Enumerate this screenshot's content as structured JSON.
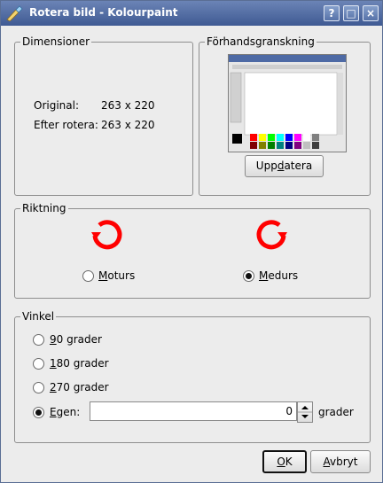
{
  "window": {
    "title": "Rotera bild - Kolourpaint",
    "icon": "kolourpaint-brush-icon",
    "buttons": [
      "?",
      "□",
      "×"
    ]
  },
  "dimensions": {
    "title": "Dimensioner",
    "original_label": "Original:",
    "original_value": "263 x 220",
    "after_label": "Efter rotera:",
    "after_value": "263 x 220"
  },
  "preview": {
    "title": "Förhandsgranskning",
    "update_button": {
      "before": "Upp",
      "mnemonic": "d",
      "after": "atera"
    }
  },
  "direction": {
    "title": "Riktning",
    "counterclockwise": {
      "mnemonic": "M",
      "rest": "oturs",
      "checked": false,
      "icon": "rotate-counterclockwise-icon"
    },
    "clockwise": {
      "mnemonic": "M",
      "rest": "edurs",
      "checked": true,
      "icon": "rotate-clockwise-icon"
    }
  },
  "angle": {
    "title": "Vinkel",
    "opt90": {
      "mnemonic": "9",
      "rest": "0 grader",
      "checked": false
    },
    "opt180": {
      "mnemonic": "1",
      "rest": "80 grader",
      "checked": false
    },
    "opt270": {
      "mnemonic": "2",
      "rest": "70 grader",
      "checked": false
    },
    "custom": {
      "mnemonic": "E",
      "rest": "gen:",
      "checked": true,
      "value": "0",
      "unit": "grader"
    }
  },
  "ok_button": {
    "mnemonic": "O",
    "rest": "K"
  },
  "cancel_button": {
    "mnemonic": "A",
    "rest": "vbryt"
  },
  "colors": {
    "accent_red": "#ff0000",
    "titlebar": "#4f6aa3"
  }
}
